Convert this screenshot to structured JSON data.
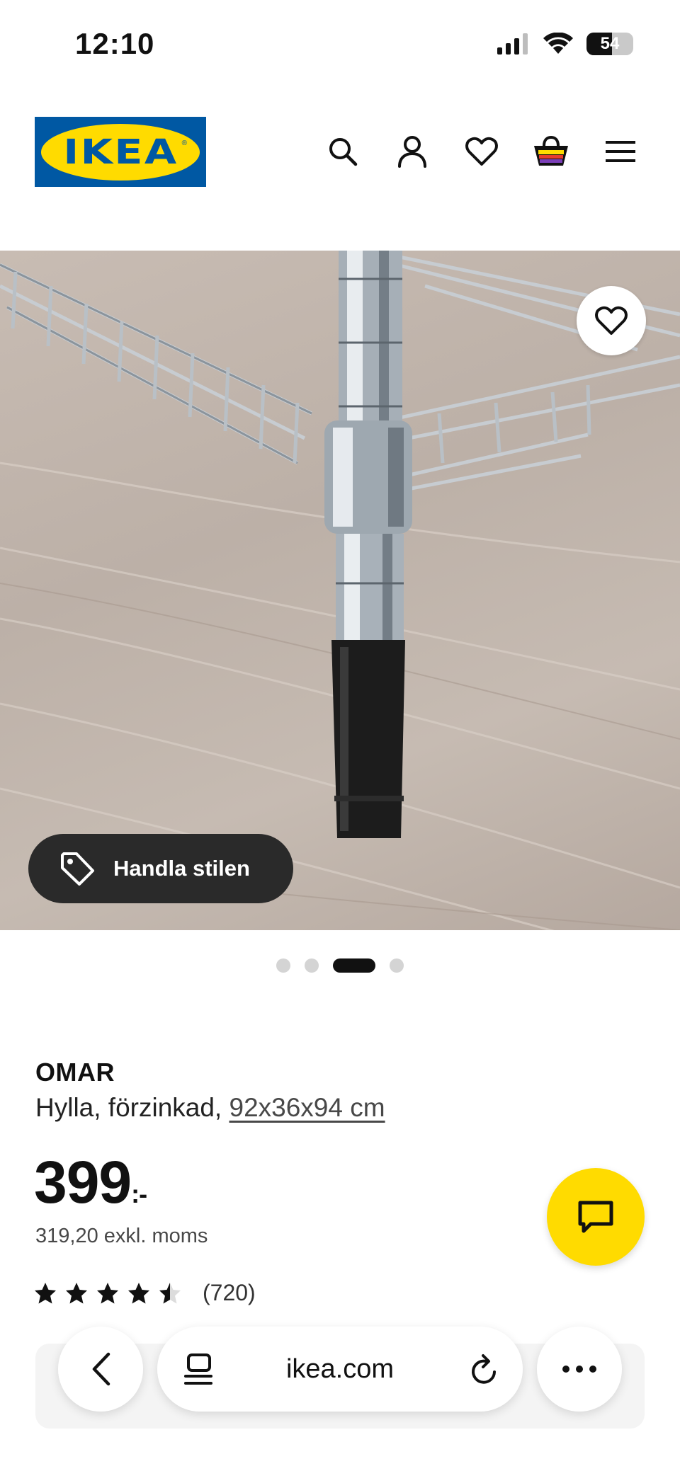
{
  "status_bar": {
    "time": "12:10",
    "battery": "54",
    "battery_level": 0.54
  },
  "header": {
    "logo_text": "IKEA",
    "icons": [
      "search-icon",
      "account-icon",
      "heart-icon",
      "shopping-bag-icon",
      "menu-icon"
    ]
  },
  "gallery": {
    "shop_style_label": "Handla stilen",
    "dots_count": 4,
    "active_dot": 3
  },
  "product": {
    "brand": "OMAR",
    "description": "Hylla, förzinkad, ",
    "size": "92x36x94 cm",
    "price": "399",
    "price_suffix": ":-",
    "ex_vat": "319,20 exkl. moms",
    "rating": 4.5,
    "review_count": "(720)"
  },
  "browser": {
    "url": "ikea.com"
  },
  "colors": {
    "ikea_blue": "#0058a3",
    "ikea_yellow": "#ffdb00",
    "text": "#111111"
  }
}
